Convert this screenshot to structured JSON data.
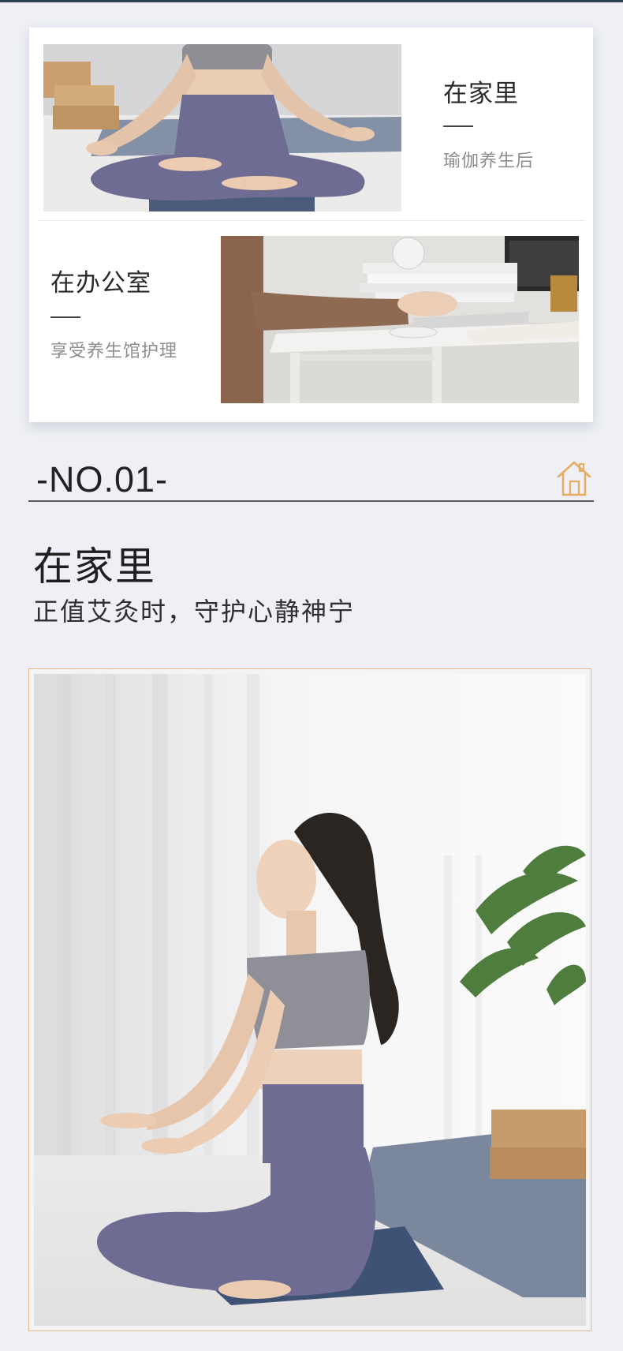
{
  "scenes": [
    {
      "title": "在家里",
      "subtitle": "瑜伽养生后",
      "photo": "meditation-at-home-photo"
    },
    {
      "title": "在办公室",
      "subtitle": "享受养生馆护理",
      "photo": "typing-at-office-desk-photo"
    }
  ],
  "section": {
    "number": "-NO.01-",
    "icon": "house-icon",
    "heading": "在家里",
    "subheading": "正值艾灸时，守护心静神宁",
    "photo": "woman-meditating-photo"
  },
  "colors": {
    "page_background": "#eef0f5",
    "accent_gold": "#e7ac63",
    "frame_border": "#e4b98f",
    "top_strip": "#2b4152",
    "legging_purple": "#6e6c93"
  }
}
